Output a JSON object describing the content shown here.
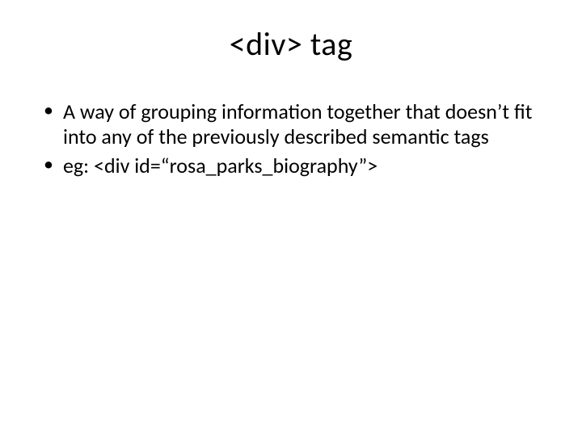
{
  "title": "<div> tag",
  "bullets": [
    "A way of grouping information together that doesn’t fit into any of the previously described semantic tags",
    "eg:  <div id=“rosa_parks_biography”>"
  ]
}
